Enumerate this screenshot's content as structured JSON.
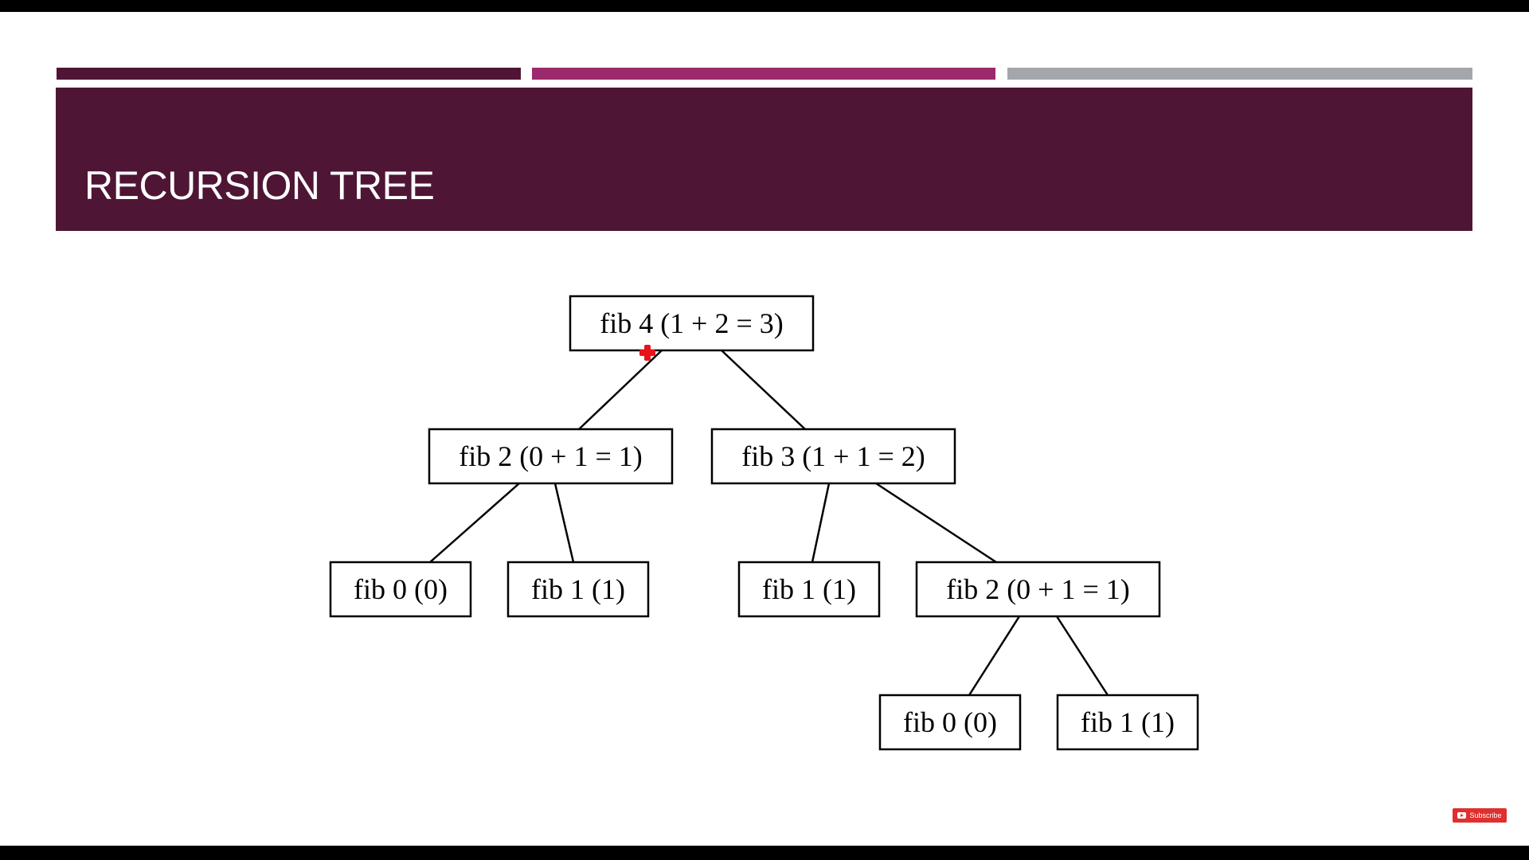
{
  "slide": {
    "title": "RECURSION TREE",
    "colors": {
      "band": "#4f1535",
      "accent_1": "#4f1535",
      "accent_2": "#9c2a6a",
      "accent_3": "#a3a7ab"
    }
  },
  "tree": {
    "nodes": [
      {
        "id": "n-root",
        "label": "fib 4 (1 + 2 = 3)"
      },
      {
        "id": "n-l",
        "label": "fib 2 (0 + 1 = 1)"
      },
      {
        "id": "n-r",
        "label": "fib 3 (1 + 1 = 2)"
      },
      {
        "id": "n-ll",
        "label": "fib 0 (0)"
      },
      {
        "id": "n-lr",
        "label": "fib 1 (1)"
      },
      {
        "id": "n-rl",
        "label": "fib 1 (1)"
      },
      {
        "id": "n-rr",
        "label": "fib 2 (0 + 1 = 1)"
      },
      {
        "id": "n-rrl",
        "label": "fib 0 (0)"
      },
      {
        "id": "n-rrr",
        "label": "fib 1 (1)"
      }
    ],
    "edges": [
      [
        "n-root",
        "n-l"
      ],
      [
        "n-root",
        "n-r"
      ],
      [
        "n-l",
        "n-ll"
      ],
      [
        "n-l",
        "n-lr"
      ],
      [
        "n-r",
        "n-rl"
      ],
      [
        "n-r",
        "n-rr"
      ],
      [
        "n-rr",
        "n-rrl"
      ],
      [
        "n-rr",
        "n-rrr"
      ]
    ]
  },
  "overlay": {
    "subscribe_label": "Subscribe",
    "subscribe_color": "#e02f2f",
    "cursor_color": "#e8141b"
  }
}
